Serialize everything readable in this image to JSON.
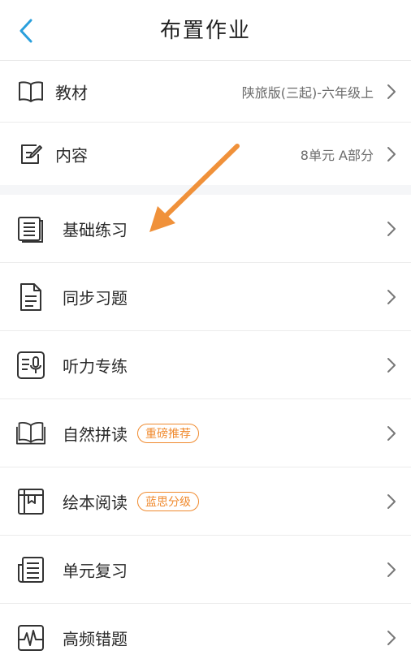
{
  "header": {
    "title": "布置作业",
    "back_icon": "chevron-left-icon"
  },
  "settings": [
    {
      "label": "教材",
      "value": "陕旅版(三起)-六年级上",
      "icon": "book-icon"
    },
    {
      "label": "内容",
      "value": "8单元 A部分",
      "icon": "edit-icon"
    }
  ],
  "tasks": [
    {
      "label": "基础练习",
      "icon": "stacked-document-icon"
    },
    {
      "label": "同步习题",
      "icon": "document-icon"
    },
    {
      "label": "听力专练",
      "icon": "microphone-document-icon"
    },
    {
      "label": "自然拼读",
      "icon": "open-book-icon",
      "badge": "重磅推荐"
    },
    {
      "label": "绘本阅读",
      "icon": "picture-book-icon",
      "badge": "蓝思分级"
    },
    {
      "label": "单元复习",
      "icon": "newspaper-icon"
    },
    {
      "label": "高频错题",
      "icon": "heartbeat-icon"
    }
  ],
  "colors": {
    "accent": "#2a9fdc",
    "badge": "#f08a2e",
    "arrow": "#f0913a"
  }
}
